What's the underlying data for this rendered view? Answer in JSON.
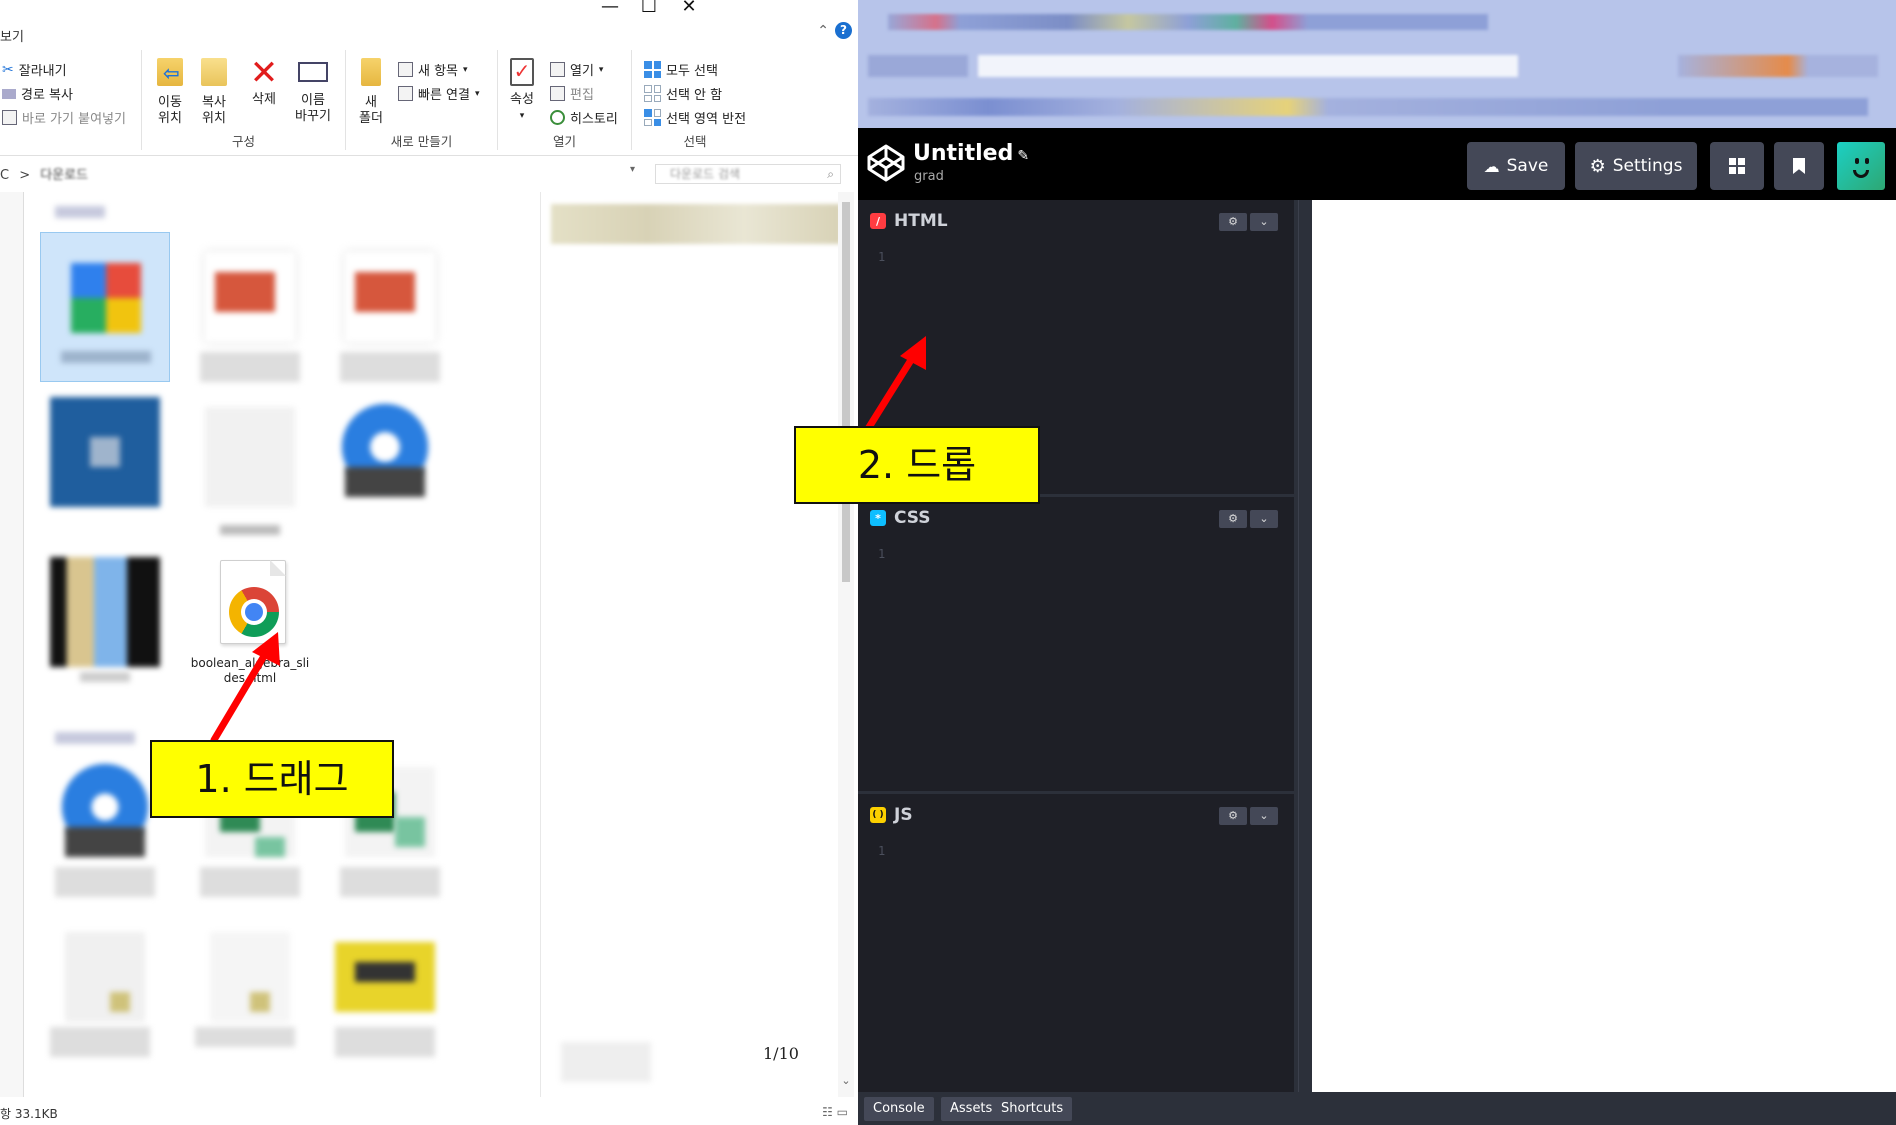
{
  "explorer": {
    "tab_partial": "보기",
    "window_controls": {
      "minimize": "—",
      "maximize": "☐",
      "close": "✕"
    },
    "help": "?",
    "ribbon": {
      "clipboard": {
        "cut": "잘라내기",
        "copy_path": "경로 복사",
        "paste_shortcut": "바로 가기 붙여넣기"
      },
      "organize": {
        "label": "구성",
        "move_to_l1": "이동",
        "move_to_l2": "위치",
        "copy_to_l1": "복사",
        "copy_to_l2": "위치",
        "delete": "삭제",
        "rename_l1": "이름",
        "rename_l2": "바꾸기"
      },
      "new": {
        "label": "새로 만들기",
        "new_folder_l1": "새",
        "new_folder_l2": "폴더",
        "new_item": "새 항목",
        "easy_access": "빠른 연결"
      },
      "open": {
        "label": "열기",
        "properties": "속성",
        "open": "열기",
        "edit": "편집",
        "history": "히스토리"
      },
      "select": {
        "label": "선택",
        "select_all": "모두 선택",
        "select_none": "선택 안 함",
        "invert": "선택 영역 반전"
      }
    },
    "address": {
      "drive": "C",
      "separator": ">",
      "folder": "다운로드"
    },
    "search_placeholder": "다운로드 검색",
    "file": {
      "name_l1": "boolean_algebra_sli",
      "name_l2": "des.html"
    },
    "page_counter": "1/10",
    "status_size": "항 33.1KB"
  },
  "annotations": {
    "drag": "1. 드래그",
    "drop": "2. 드롭"
  },
  "codepen": {
    "title": "Untitled",
    "pencil": "✎",
    "user": "grad",
    "buttons": {
      "save": "Save",
      "settings": "Settings"
    },
    "panels": [
      {
        "name": "HTML",
        "badge": "/",
        "badge_color": "#ff3c41",
        "line": "1"
      },
      {
        "name": "CSS",
        "badge": "*",
        "badge_color": "#0ebeff",
        "line": "1"
      },
      {
        "name": "JS",
        "badge": "( )",
        "badge_color": "#fcd000",
        "line": "1"
      }
    ],
    "tool_gear": "⚙",
    "tool_chevron": "⌄",
    "footer": {
      "console": "Console",
      "assets": "Assets",
      "shortcuts": "Shortcuts"
    }
  },
  "colors": {
    "callout": "#ffff00",
    "arrow": "#ff0000",
    "codepen_bg": "#1e1f26",
    "codepen_btn": "#444857"
  }
}
